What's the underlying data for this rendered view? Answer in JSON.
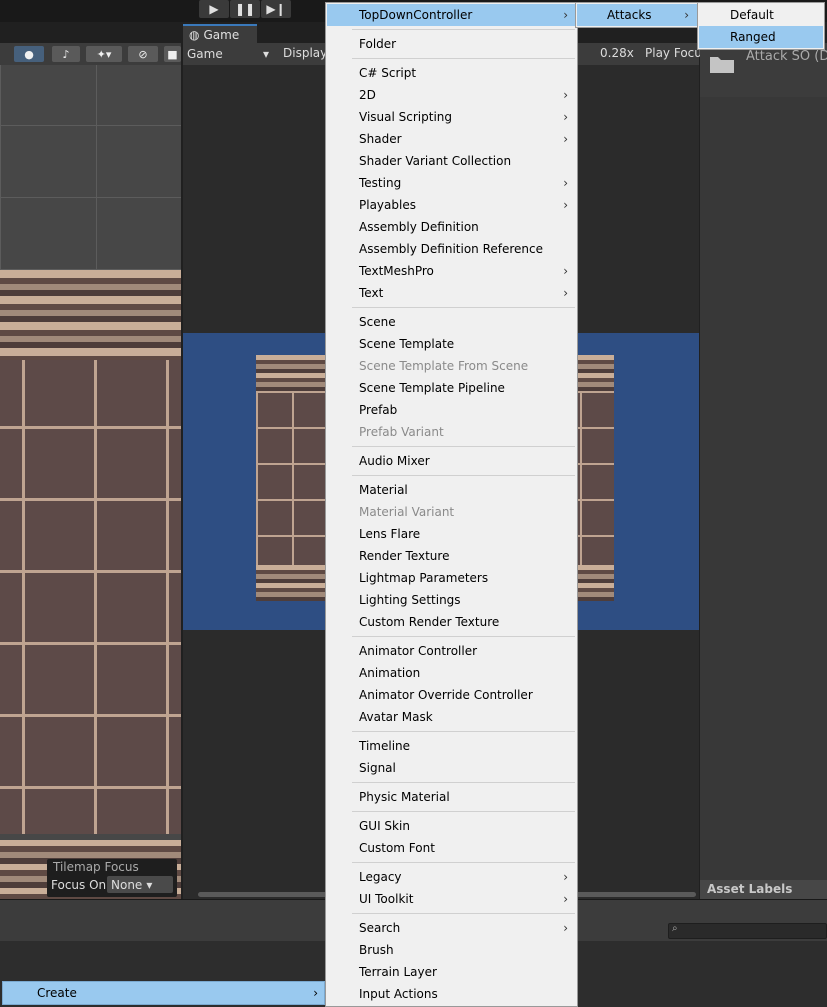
{
  "toolbar": {
    "play_icon": "play-icon",
    "pause_icon": "pause-icon",
    "step_icon": "step-icon"
  },
  "scene": {
    "tilemap_focus": {
      "title": "Tilemap Focus",
      "focus_label": "Focus On",
      "focus_value": "None"
    }
  },
  "game": {
    "tab_label": "Game",
    "dropdown_value": "Game",
    "display_label": "Display",
    "zoom_value": "0.28x",
    "play_focus_label": "Play Focu"
  },
  "inspector": {
    "asset_title": "Attack SO (D",
    "asset_labels": "Asset Labels"
  },
  "create_row": {
    "label": "Create"
  },
  "menu_main": {
    "items": [
      {
        "label": "TopDownController",
        "submenu": true,
        "highlight": true
      },
      {
        "sep": true
      },
      {
        "label": "Folder"
      },
      {
        "sep": true
      },
      {
        "label": "C# Script"
      },
      {
        "label": "2D",
        "submenu": true
      },
      {
        "label": "Visual Scripting",
        "submenu": true
      },
      {
        "label": "Shader",
        "submenu": true
      },
      {
        "label": "Shader Variant Collection"
      },
      {
        "label": "Testing",
        "submenu": true
      },
      {
        "label": "Playables",
        "submenu": true
      },
      {
        "label": "Assembly Definition"
      },
      {
        "label": "Assembly Definition Reference"
      },
      {
        "label": "TextMeshPro",
        "submenu": true
      },
      {
        "label": "Text",
        "submenu": true
      },
      {
        "sep": true
      },
      {
        "label": "Scene"
      },
      {
        "label": "Scene Template"
      },
      {
        "label": "Scene Template From Scene",
        "disabled": true
      },
      {
        "label": "Scene Template Pipeline"
      },
      {
        "label": "Prefab"
      },
      {
        "label": "Prefab Variant",
        "disabled": true
      },
      {
        "sep": true
      },
      {
        "label": "Audio Mixer"
      },
      {
        "sep": true
      },
      {
        "label": "Material"
      },
      {
        "label": "Material Variant",
        "disabled": true
      },
      {
        "label": "Lens Flare"
      },
      {
        "label": "Render Texture"
      },
      {
        "label": "Lightmap Parameters"
      },
      {
        "label": "Lighting Settings"
      },
      {
        "label": "Custom Render Texture"
      },
      {
        "sep": true
      },
      {
        "label": "Animator Controller"
      },
      {
        "label": "Animation"
      },
      {
        "label": "Animator Override Controller"
      },
      {
        "label": "Avatar Mask"
      },
      {
        "sep": true
      },
      {
        "label": "Timeline"
      },
      {
        "label": "Signal"
      },
      {
        "sep": true
      },
      {
        "label": "Physic Material"
      },
      {
        "sep": true
      },
      {
        "label": "GUI Skin"
      },
      {
        "label": "Custom Font"
      },
      {
        "sep": true
      },
      {
        "label": "Legacy",
        "submenu": true
      },
      {
        "label": "UI Toolkit",
        "submenu": true
      },
      {
        "sep": true
      },
      {
        "label": "Search",
        "submenu": true
      },
      {
        "label": "Brush"
      },
      {
        "label": "Terrain Layer"
      },
      {
        "label": "Input Actions"
      }
    ]
  },
  "menu_attacks": {
    "items": [
      {
        "label": "Attacks",
        "submenu": true,
        "highlight": true
      }
    ]
  },
  "menu_types": {
    "items": [
      {
        "label": "Default"
      },
      {
        "label": "Ranged",
        "highlight": true
      }
    ]
  },
  "colors": {
    "menu_bg": "#f0f0f0",
    "highlight": "#99c9ef",
    "game_bg_blue": "#2e4e83",
    "editor_dark": "#202020"
  }
}
